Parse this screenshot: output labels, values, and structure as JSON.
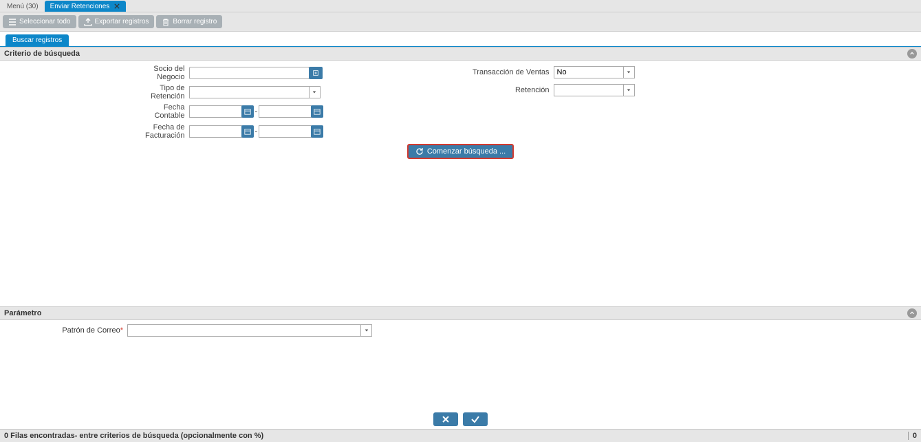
{
  "tabs": {
    "menu": "Menú (30)",
    "active": "Enviar Retenciones"
  },
  "toolbar": {
    "select_all": "Seleccionar todo",
    "export": "Exportar registros",
    "delete": "Borrar registro"
  },
  "subtab": {
    "search": "Buscar registros"
  },
  "criteria": {
    "header": "Criterio de búsqueda",
    "socio_label_1": "Socio del",
    "socio_label_2": "Negocio",
    "tipo_label_1": "Tipo de",
    "tipo_label_2": "Retención",
    "fecha_cont_1": "Fecha",
    "fecha_cont_2": "Contable",
    "fecha_fact_1": "Fecha de",
    "fecha_fact_2": "Facturación",
    "trans_ventas": "Transacción de Ventas",
    "trans_value": "No",
    "retencion": "Retención",
    "search_btn": "Comenzar búsqueda ..."
  },
  "param": {
    "header": "Parámetro",
    "patron_label": "Patrón de Correo",
    "req": "*"
  },
  "status": {
    "left": "0 Filas encontradas- entre criterios de búsqueda (opcionalmente con %)",
    "right": "0"
  }
}
